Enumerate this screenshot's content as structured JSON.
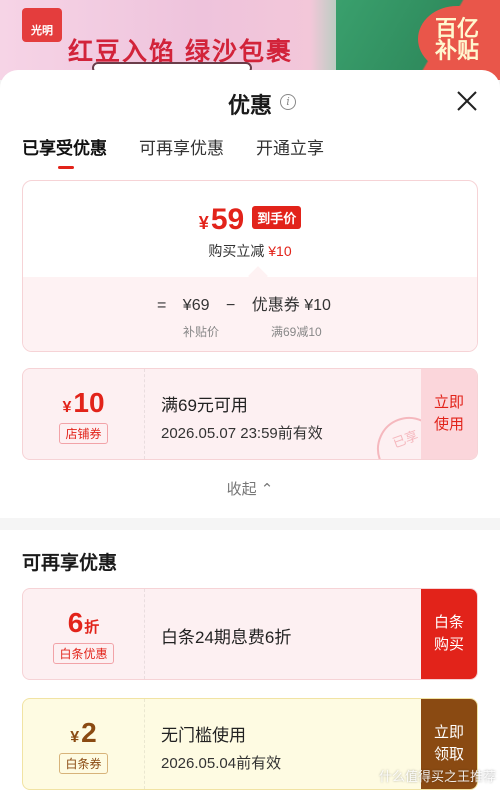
{
  "banner": {
    "brand": "光明",
    "headline": "红豆入馅 绿沙包裹",
    "promo": "百亿\n补贴"
  },
  "sheet": {
    "title": "优惠",
    "tabs": [
      "已享受优惠",
      "可再享优惠",
      "开通立享"
    ],
    "active_tab": 0
  },
  "summary": {
    "price_symbol": "¥",
    "price": "59",
    "price_tag": "到手价",
    "reduce_label": "购买立减",
    "reduce_amount": "¥10",
    "calc": {
      "equals": "=",
      "base": "¥69",
      "minus": "−",
      "coupon": "优惠券 ¥10",
      "base_label": "补贴价",
      "coupon_label": "满69减10"
    }
  },
  "coupons_applied": [
    {
      "symbol": "¥",
      "amount": "10",
      "tag": "店铺券",
      "line1": "满69元可用",
      "line2": "2026.05.07 23:59前有效",
      "action": "立即\n使用",
      "stamp": "已享"
    }
  ],
  "collapse_label": "收起",
  "more_section": {
    "title": "可再享优惠",
    "items": [
      {
        "amount": "6",
        "unit": "折",
        "tag": "白条优惠",
        "line1": "白条24期息费6折",
        "action": "白条\n购买"
      },
      {
        "symbol": "¥",
        "amount": "2",
        "tag": "白条券",
        "line1": "无门槛使用",
        "line2": "2026.05.04前有效",
        "action": "立即\n领取"
      }
    ]
  },
  "watermark": "什么值得买之王推荐",
  "colors": {
    "accent": "#e2231a",
    "baitiao_brown": "#8a4a12"
  }
}
